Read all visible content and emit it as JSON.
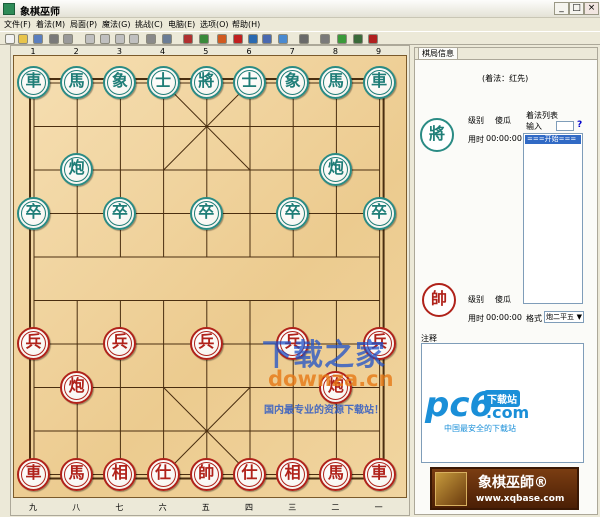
{
  "window": {
    "title": "象棋巫师",
    "min": "_",
    "max": "□",
    "close": "×"
  },
  "menu": [
    "文件(F)",
    "着法(M)",
    "局面(P)",
    "魔法(G)",
    "挑战(C)",
    "电脑(E)",
    "选项(O)",
    "帮助(H)"
  ],
  "toolbar_icons": [
    "new-icon",
    "open-icon",
    "save-icon",
    "print-icon",
    "copy-icon",
    "first-icon",
    "prev-icon",
    "next-icon",
    "last-icon",
    "delete-icon",
    "board-icon",
    "edit-icon",
    "computer-icon",
    "color-icon",
    "eye-icon",
    "book-icon",
    "stop-icon",
    "info-icon",
    "bind-icon",
    "timer-icon",
    "play-icon",
    "screen-icon",
    "disable-icon"
  ],
  "board": {
    "top_labels": [
      "1",
      "2",
      "3",
      "4",
      "5",
      "6",
      "7",
      "8",
      "9"
    ],
    "bottom_labels": [
      "九",
      "八",
      "七",
      "六",
      "五",
      "四",
      "三",
      "二",
      "一"
    ],
    "pieces": [
      {
        "c": "車",
        "side": "black"
      },
      {
        "c": "馬",
        "side": "black"
      },
      {
        "c": "象",
        "side": "black"
      },
      {
        "c": "士",
        "side": "black"
      },
      {
        "c": "將",
        "side": "black"
      },
      {
        "c": "士",
        "side": "black"
      },
      {
        "c": "象",
        "side": "black"
      },
      {
        "c": "馬",
        "side": "black"
      },
      {
        "c": "車",
        "side": "black"
      },
      {
        "c": "炮",
        "side": "black"
      },
      {
        "c": "炮",
        "side": "black"
      },
      {
        "c": "卒",
        "side": "black"
      },
      {
        "c": "卒",
        "side": "black"
      },
      {
        "c": "卒",
        "side": "black"
      },
      {
        "c": "卒",
        "side": "black"
      },
      {
        "c": "卒",
        "side": "black"
      },
      {
        "c": "兵",
        "side": "red"
      },
      {
        "c": "兵",
        "side": "red"
      },
      {
        "c": "兵",
        "side": "red"
      },
      {
        "c": "兵",
        "side": "red"
      },
      {
        "c": "兵",
        "side": "red"
      },
      {
        "c": "炮",
        "side": "red"
      },
      {
        "c": "炮",
        "side": "red"
      },
      {
        "c": "車",
        "side": "red"
      },
      {
        "c": "馬",
        "side": "red"
      },
      {
        "c": "相",
        "side": "red"
      },
      {
        "c": "仕",
        "side": "red"
      },
      {
        "c": "帥",
        "side": "red"
      },
      {
        "c": "仕",
        "side": "red"
      },
      {
        "c": "相",
        "side": "red"
      },
      {
        "c": "馬",
        "side": "red"
      },
      {
        "c": "車",
        "side": "red"
      }
    ]
  },
  "panel": {
    "tab": "棋局信息",
    "move_title": "(着法：红先)",
    "top_player": {
      "piece": "將",
      "level_label": "级别",
      "level": "傻瓜",
      "time_label": "用时",
      "time": "00:00:00"
    },
    "bottom_player": {
      "piece": "帥",
      "level_label": "级别",
      "level": "傻瓜",
      "time_label": "用时",
      "time": "00:00:00"
    },
    "movelist_label": "着法列表",
    "input_label": "输入",
    "help": "?",
    "movelist_item": "===开始===",
    "format_label": "格式",
    "format_value": "炮二平五",
    "comment_label": "注释"
  },
  "logo": {
    "name": "象棋巫師®",
    "url": "www.xqbase.com"
  },
  "watermark": {
    "line1": "下载之家",
    "line2": "downza.cn",
    "line3": "国内最专业的资源下载站！",
    "pc6": "pc6",
    "pc6_dl": "下载站",
    "pc6_com": ".com",
    "pc6_sub": "中国最安全的下载站"
  }
}
